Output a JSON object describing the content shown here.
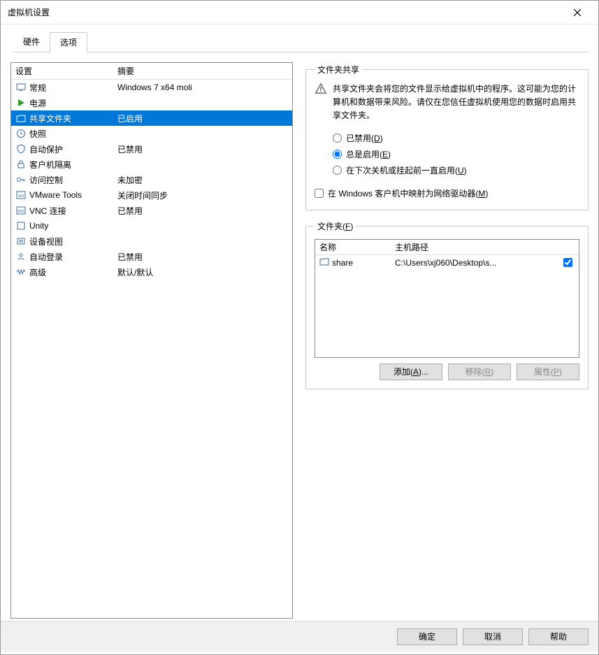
{
  "window": {
    "title": "虚拟机设置"
  },
  "tabs": {
    "hardware": "硬件",
    "options": "选项"
  },
  "list": {
    "header": {
      "setting": "设置",
      "summary": "摘要"
    },
    "rows": [
      {
        "icon": "monitor",
        "label": "常规",
        "summary": "Windows 7 x64 moli"
      },
      {
        "icon": "play",
        "label": "电源",
        "summary": ""
      },
      {
        "icon": "folder-share",
        "label": "共享文件夹",
        "summary": "已启用",
        "selected": true
      },
      {
        "icon": "clock",
        "label": "快照",
        "summary": ""
      },
      {
        "icon": "shield",
        "label": "自动保护",
        "summary": "已禁用"
      },
      {
        "icon": "lock",
        "label": "客户机隔离",
        "summary": ""
      },
      {
        "icon": "key",
        "label": "访问控制",
        "summary": "未加密"
      },
      {
        "icon": "vm",
        "label": "VMware Tools",
        "summary": "关闭时间同步"
      },
      {
        "icon": "vnc",
        "label": "VNC 连接",
        "summary": "已禁用"
      },
      {
        "icon": "unity",
        "label": "Unity",
        "summary": ""
      },
      {
        "icon": "device",
        "label": "设备视图",
        "summary": ""
      },
      {
        "icon": "autologin",
        "label": "自动登录",
        "summary": "已禁用"
      },
      {
        "icon": "wave",
        "label": "高级",
        "summary": "默认/默认"
      }
    ]
  },
  "share": {
    "groupTitle": "文件夹共享",
    "warning": "共享文件夹会将您的文件显示给虚拟机中的程序。这可能为您的计算机和数据带来风险。请仅在您信任虚拟机使用您的数据时启用共享文件夹。",
    "radio": {
      "disabled": "已禁用(D)",
      "always": "总是启用(E)",
      "untilNext": "在下次关机或挂起前一直启用(U)"
    },
    "mapCheck": "在 Windows 客户机中映射为网络驱动器(M)"
  },
  "folders": {
    "groupTitle": "文件夹(F)",
    "cols": {
      "name": "名称",
      "path": "主机路径"
    },
    "rows": [
      {
        "name": "share",
        "path": "C:\\Users\\xj060\\Desktop\\s...",
        "checked": true
      }
    ],
    "buttons": {
      "add": "添加(A)...",
      "remove": "移除(R)",
      "props": "属性(P)"
    }
  },
  "footer": {
    "ok": "确定",
    "cancel": "取消",
    "help": "帮助"
  }
}
